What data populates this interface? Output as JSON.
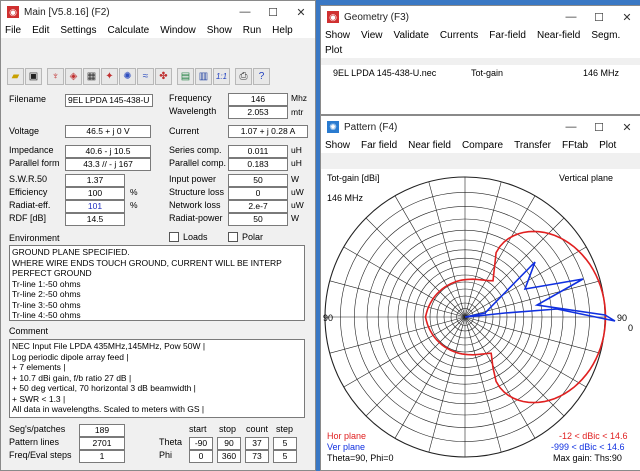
{
  "main": {
    "title": "Main [V5.8.16]  (F2)",
    "menu": [
      "File",
      "Edit",
      "Settings",
      "Calculate",
      "Window",
      "Show",
      "Run",
      "Help"
    ],
    "toolbar_icons": [
      "open-icon",
      "save-icon",
      "antenna-icon",
      "antenna-3d-icon",
      "grid-icon",
      "run-icon",
      "pattern-icon",
      "freq-sweep-icon",
      "optimize-icon",
      "calculator-icon",
      "notes-icon",
      "ratio-icon",
      "printer-icon",
      "help-icon"
    ],
    "filename_label": "Filename",
    "filename": "9EL LPDA 145-438-U",
    "frequency_label": "Frequency",
    "frequency": "146",
    "frequency_unit": "Mhz",
    "wavelength_label": "Wavelength",
    "wavelength": "2.053",
    "wavelength_unit": "mtr",
    "voltage_label": "Voltage",
    "voltage": "46.5 + j 0 V",
    "current_label": "Current",
    "current": "1.07 + j 0.28 A",
    "impedance_label": "Impedance",
    "impedance": "40.6 - j 10.5",
    "series_label": "Series comp.",
    "series": "0.011",
    "series_unit": "uH",
    "parallel_form_label": "Parallel form",
    "parallel_form": "43.3 // - j 167",
    "parallel_comp_label": "Parallel comp.",
    "parallel_comp": "0.183",
    "parallel_comp_unit": "uH",
    "swr_label": "S.W.R.50",
    "swr": "1.37",
    "input_power_label": "Input power",
    "input_power": "50",
    "input_power_unit": "W",
    "efficiency_label": "Efficiency",
    "efficiency": "100",
    "efficiency_unit": "%",
    "structure_loss_label": "Structure loss",
    "structure_loss": "0",
    "structure_loss_unit": "uW",
    "radiat_eff_label": "Radiat-eff.",
    "radiat_eff": "101",
    "radiat_eff_unit": "%",
    "network_loss_label": "Network loss",
    "network_loss": "2.e-7",
    "network_loss_unit": "uW",
    "rdf_label": "RDF [dB]",
    "rdf": "14.5",
    "radiat_power_label": "Radiat-power",
    "radiat_power": "50",
    "radiat_power_unit": "W",
    "loads_label": "Loads",
    "polar_label": "Polar",
    "environment_label": "Environment",
    "environment_lines": [
      "GROUND PLANE SPECIFIED.",
      "WHERE WIRE ENDS TOUCH GROUND, CURRENT WILL BE INTERP",
      "PERFECT GROUND",
      "Tr-line  1:-50 ohms",
      "Tr-line  2:-50 ohms",
      "Tr-line  3:-50 ohms",
      "Tr-line  4:-50 ohms"
    ],
    "comment_label": "Comment",
    "comment_lines": [
      "NEC Input File LPDA 435MHz,145MHz, Pow 50W  |",
      "Log periodic dipole array feed                    |",
      "+ 7 elements                                    |",
      "+ 10.7 dBi gain, f/b ratio 27 dB          |",
      "+ 50 deg vertical, 70 horizontal 3 dB beamwidth |",
      "+ SWR < 1.3                                       |",
      "All data in wavelengths. Scaled to meters with GS |"
    ],
    "segs_label": "Seg's/patches",
    "segs": "189",
    "pattern_lines_label": "Pattern lines",
    "pattern_lines": "2701",
    "freq_eval_label": "Freq/Eval steps",
    "freq_steps": "1",
    "eval_steps": "0",
    "sweep_headers": [
      "start",
      "stop",
      "count",
      "step"
    ],
    "theta_label": "Theta",
    "theta": [
      "-90",
      "90",
      "37",
      "5"
    ],
    "phi_label": "Phi",
    "phi": [
      "0",
      "360",
      "73",
      "5"
    ]
  },
  "geometry": {
    "title": "Geometry   (F3)",
    "menu": [
      "Show",
      "View",
      "Validate",
      "Currents",
      "Far-field",
      "Near-field",
      "Segm.",
      "Plot"
    ],
    "file": "9EL LPDA 145-438-U.nec",
    "gain_label": "Tot-gain",
    "freq": "146 MHz"
  },
  "pattern": {
    "title": "Pattern   (F4)",
    "menu": [
      "Show",
      "Far field",
      "Near field",
      "Compare",
      "Transfer",
      "FFtab",
      "Plot"
    ],
    "gain_label": "Tot-gain [dBi]",
    "plane_label": "Vertical plane",
    "freq": "146 MHz",
    "angle_labels": [
      "90",
      "90",
      "0"
    ],
    "hor_plane": "Hor plane",
    "hor_range": "-12 < dBic < 14.6",
    "ver_plane": "Ver plane",
    "ver_range": "-999 < dBic < 14.6",
    "angles": "Theta=90, Phi=0",
    "max_gain": "Max gain: Ths:90",
    "hor_color": "#e02020",
    "ver_color": "#1030e0"
  }
}
